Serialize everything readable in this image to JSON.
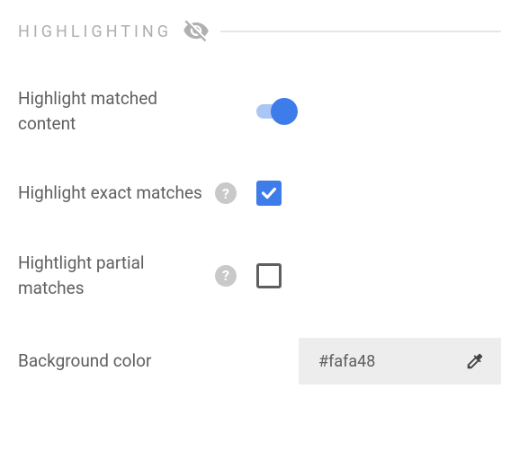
{
  "section": {
    "title": "HIGHLIGHTING"
  },
  "options": {
    "highlightMatched": {
      "label": "Highlight matched content"
    },
    "highlightExact": {
      "label": "Highlight exact matches",
      "help": "?"
    },
    "highlightPartial": {
      "label": "Hightlight partial matches",
      "help": "?"
    },
    "backgroundColor": {
      "label": "Background color",
      "value": "#fafa48"
    }
  }
}
